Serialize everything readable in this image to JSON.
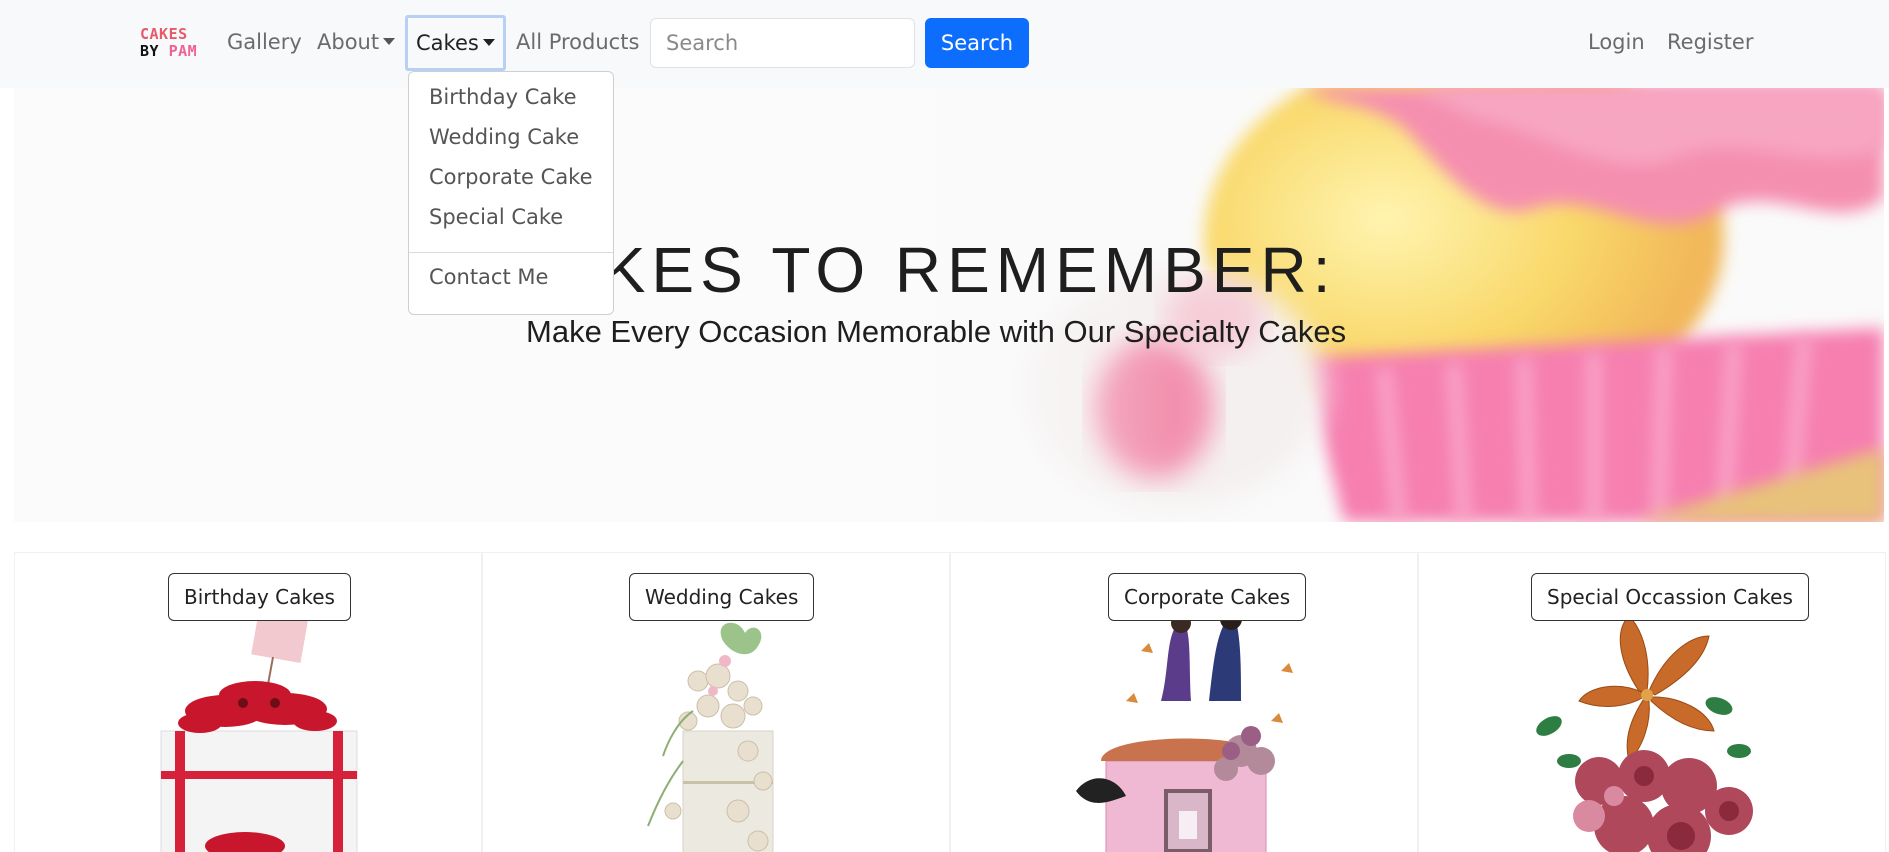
{
  "logo": {
    "line1": "CAKES",
    "line2_by": "BY",
    "line2_name": "PAM"
  },
  "nav": {
    "gallery": "Gallery",
    "about": "About",
    "cakes": "Cakes",
    "all_products": "All Products",
    "search_placeholder": "Search",
    "search_button": "Search",
    "login": "Login",
    "register": "Register"
  },
  "dropdown": {
    "items": [
      "Birthday Cake",
      "Wedding Cake",
      "Corporate Cake",
      "Special Cake"
    ],
    "contact": "Contact Me"
  },
  "hero": {
    "title": "AKES TO REMEMBER:",
    "subtitle": "Make Every Occasion Memorable with Our Specialty Cakes"
  },
  "cards": [
    {
      "label": "Birthday Cakes"
    },
    {
      "label": "Wedding Cakes"
    },
    {
      "label": "Corporate Cakes"
    },
    {
      "label": "Special Occassion Cakes"
    }
  ],
  "colors": {
    "primary": "#0d6efd",
    "navbar_bg": "#f8f9fa",
    "logo_red": "#e85a6a",
    "logo_pink": "#f06292"
  }
}
